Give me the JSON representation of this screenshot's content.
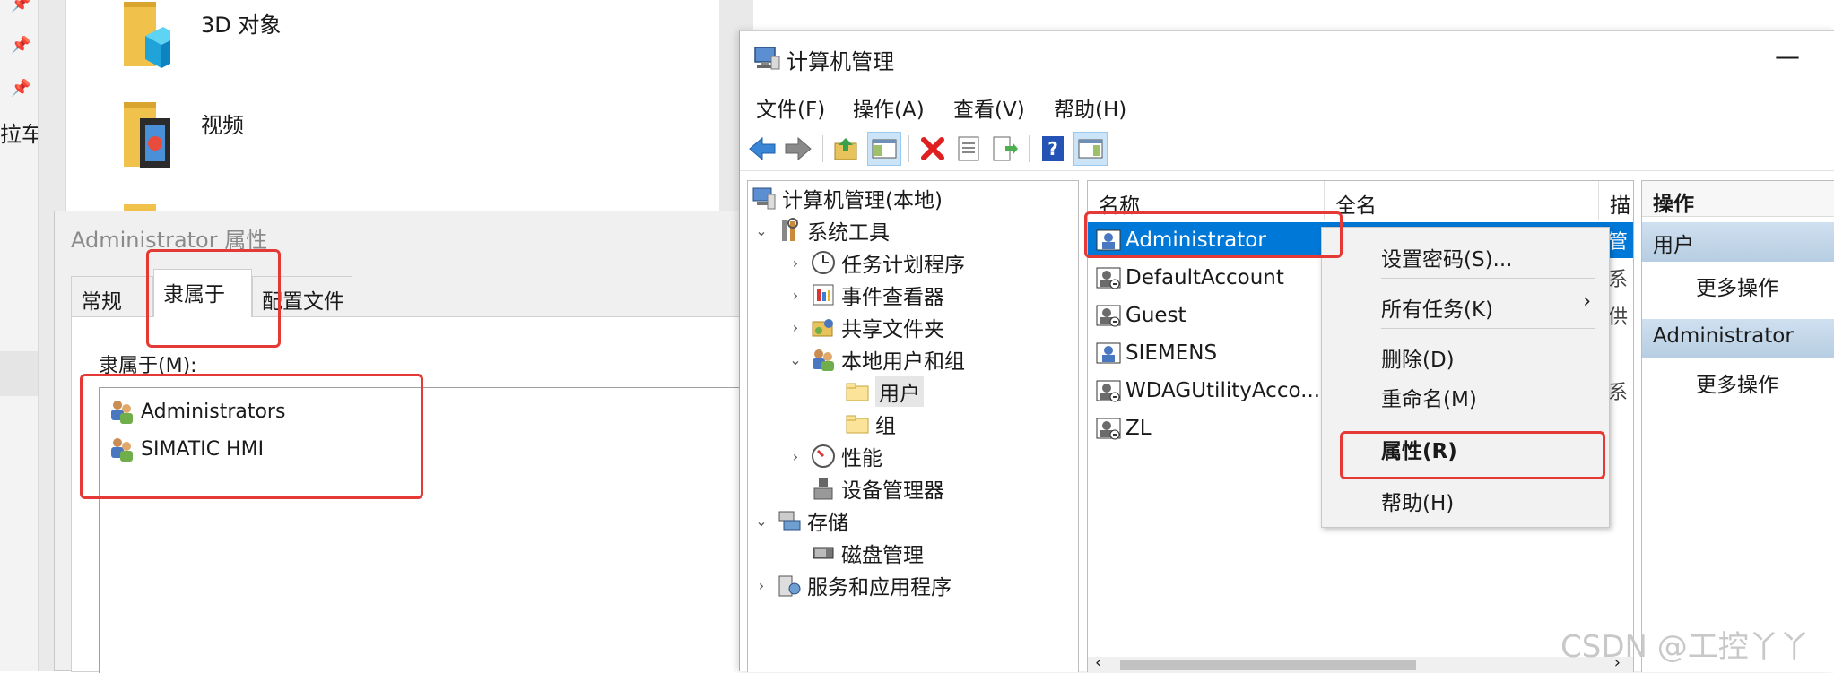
{
  "explorer": {
    "nav_cut_label": "拉车i",
    "folders": [
      {
        "label": "3D 对象",
        "icon": "3d-objects-folder-icon"
      },
      {
        "label": "视频",
        "icon": "videos-folder-icon"
      }
    ]
  },
  "properties_dialog": {
    "title": "Administrator 属性",
    "tabs": [
      "常规",
      "隶属于",
      "配置文件"
    ],
    "active_tab": "隶属于",
    "member_of_label": "隶属于(M):",
    "members": [
      "Administrators",
      "SIMATIC HMI"
    ]
  },
  "computer_management": {
    "title": "计算机管理",
    "minimize_label": "—",
    "menu": [
      "文件(F)",
      "操作(A)",
      "查看(V)",
      "帮助(H)"
    ],
    "toolbar_icons": [
      "back-arrow-icon",
      "forward-arrow-icon",
      "up-folder-icon",
      "show-hide-tree-icon",
      "delete-icon",
      "properties-icon",
      "export-list-icon",
      "help-icon",
      "show-hide-action-pane-icon"
    ],
    "tree": {
      "root": "计算机管理(本地)",
      "system_tools": "系统工具",
      "task_scheduler": "任务计划程序",
      "event_viewer": "事件查看器",
      "shared_folders": "共享文件夹",
      "local_users_groups": "本地用户和组",
      "users": "用户",
      "groups": "组",
      "performance": "性能",
      "device_manager": "设备管理器",
      "storage": "存储",
      "disk_management": "磁盘管理",
      "services_apps": "服务和应用程序",
      "selected": "用户"
    },
    "list": {
      "columns": [
        "名称",
        "全名",
        "描"
      ],
      "rows": [
        {
          "name": "Administrator",
          "desc": "管"
        },
        {
          "name": "DefaultAccount",
          "desc": "系"
        },
        {
          "name": "Guest",
          "desc": "供"
        },
        {
          "name": "SIEMENS",
          "desc": ""
        },
        {
          "name": "WDAGUtilityAcco...",
          "desc": "系"
        },
        {
          "name": "ZL",
          "desc": ""
        }
      ],
      "selected_row": "Administrator",
      "scroll_left": "‹",
      "scroll_right": "›"
    },
    "context_menu": {
      "set_password": "设置密码(S)...",
      "all_tasks": "所有任务(K)",
      "all_tasks_arrow": "›",
      "delete": "删除(D)",
      "rename": "重命名(M)",
      "properties": "属性(R)",
      "help": "帮助(H)"
    },
    "actions": {
      "header": "操作",
      "section1": "用户",
      "section1_more": "更多操作",
      "section2": "Administrator",
      "section2_more": "更多操作"
    }
  },
  "watermark": "CSDN @工控丫丫",
  "colors": {
    "selection_blue": "#0078d7",
    "annotation_red": "#e53935",
    "action_header": "#b7cde2"
  }
}
